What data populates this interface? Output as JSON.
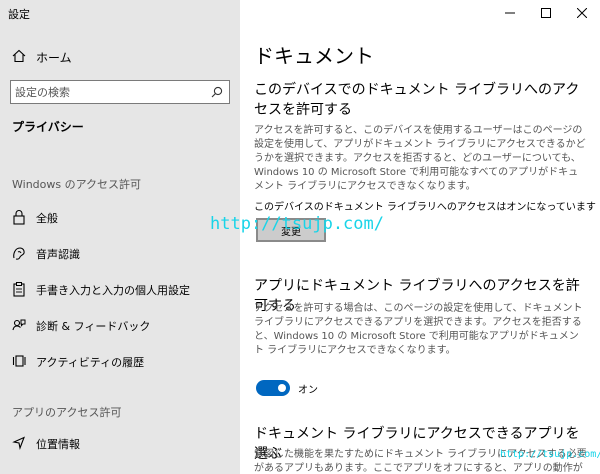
{
  "window": {
    "title": "設定"
  },
  "sidebar": {
    "home_label": "ホーム",
    "search_placeholder": "設定の検索",
    "current_section": "プライバシー",
    "group1_title": "Windows のアクセス許可",
    "group1_items": [
      {
        "label": "全般",
        "icon": "lock-icon"
      },
      {
        "label": "音声認識",
        "icon": "speech-icon"
      },
      {
        "label": "手書き入力と入力の個人用設定",
        "icon": "clipboard-icon"
      },
      {
        "label": "診断 & フィードバック",
        "icon": "feedback-icon"
      },
      {
        "label": "アクティビティの履歴",
        "icon": "activity-icon"
      }
    ],
    "group2_title": "アプリのアクセス許可",
    "group2_items": [
      {
        "label": "位置情報",
        "icon": "location-icon"
      }
    ]
  },
  "main": {
    "page_title": "ドキュメント",
    "section1_title": "このデバイスでのドキュメント ライブラリへのアクセスを許可する",
    "section1_desc": "アクセスを許可すると、このデバイスを使用するユーザーはこのページの設定を使用して、アプリがドキュメント ライブラリにアクセスできるかどうかを選択できます。アクセスを拒否すると、どのユーザーについても、Windows 10 の Microsoft Store で利用可能なすべてのアプリがドキュメント ライブラリにアクセスできなくなります。",
    "device_status": "このデバイスのドキュメント ライブラリへのアクセスはオンになっています",
    "change_button": "変更",
    "section2_title": "アプリにドキュメント ライブラリへのアクセスを許可する",
    "section2_desc": "アクセスを許可する場合は、このページの設定を使用して、ドキュメント ライブラリにアクセスできるアプリを選択できます。アクセスを拒否すると、Windows 10 の Microsoft Store で利用可能なアプリがドキュメント ライブラリにアクセスできなくなります。",
    "toggle_label": "オン",
    "toggle_on": true,
    "section3_title": "ドキュメント ライブラリにアクセスできるアプリを選ぶ",
    "section3_desc": "意図した機能を果たすためにドキュメント ライブラリにアクセスする必要があるアプリもあります。ここでアプリをオフにすると、アプリの動作が制限される可能性があります。"
  },
  "watermark": {
    "text": "http://tsujp.com/",
    "text_small": "http://tsujp.com/"
  },
  "colors": {
    "accent": "#0067c0",
    "sidebar_bg": "#e6e6e6",
    "watermark": "#19d4e8"
  }
}
